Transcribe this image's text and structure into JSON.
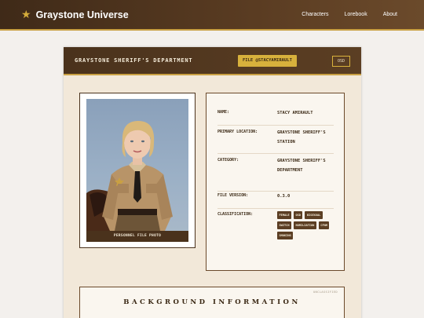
{
  "topbar": {
    "brand_icon": "star-icon",
    "title": "Graystone Universe",
    "nav": [
      "Characters",
      "Lorebook",
      "About"
    ],
    "colors": {
      "bar": "#4a321c",
      "accent": "#d6ad3b"
    }
  },
  "card": {
    "department": "GRAYSTONE SHERIFF'S DEPARTMENT",
    "file_badge": "FILE @STACYAMIRAULT",
    "content_badge": "OSD",
    "photo_caption": "PERSONNEL FILE PHOTO",
    "info": [
      {
        "label": "NAME:",
        "value": "STACY AMIRAULT"
      },
      {
        "label": "PRIMARY LOCATION:",
        "value": "GRAYSTONE SHERIFF'S STATION"
      },
      {
        "label": "CATEGORY:",
        "value": "GRAYSTONE SHERIFF'S DEPARTMENT"
      },
      {
        "label": "FILE VERSION:",
        "value": "0.3.0"
      }
    ],
    "classification_label": "CLASSIFICATION:",
    "tags": [
      "FEMALE",
      "OSD",
      "BISEXUAL",
      "SWITCH",
      "HUMILIATION",
      "CFNM",
      "SMOKING"
    ],
    "background": {
      "stamp": "UNCLASSIFIED",
      "heading": "BACKGROUND INFORMATION"
    }
  }
}
